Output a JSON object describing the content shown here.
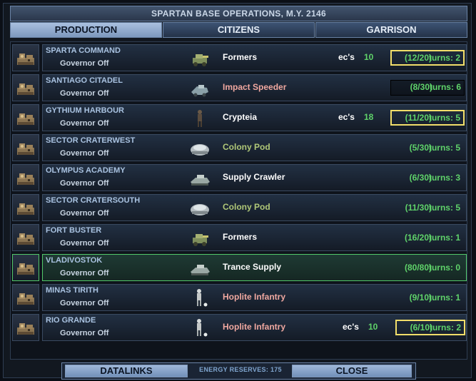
{
  "window": {
    "title": "SPARTAN BASE OPERATIONS,  M.Y. 2146"
  },
  "tabs": [
    {
      "label": "PRODUCTION",
      "active": true
    },
    {
      "label": "CITIZENS",
      "active": false
    },
    {
      "label": "GARRISON",
      "active": false
    }
  ],
  "colors": {
    "green_text": "#5fd36a",
    "white_text": "#ffffff",
    "pink_text": "#f0a8a0",
    "olive_text": "#b0c878",
    "warning_border": "#f2de6a",
    "selected_border": "#52c86a"
  },
  "bases": [
    {
      "name": "SPARTA COMMAND",
      "governor": "Governor Off",
      "unit_icon": "former-icon",
      "item": "Formers",
      "item_color": "white",
      "ec_label": "ec's",
      "ec_value": "10",
      "progress": "(12/20)",
      "turns": "turns: 2",
      "box": "warn",
      "selected": false
    },
    {
      "name": "SANTIAGO CITADEL",
      "governor": "Governor Off",
      "unit_icon": "speeder-icon",
      "item": "Impact Speeder",
      "item_color": "pink",
      "ec_label": "",
      "ec_value": "",
      "progress": "(8/30)",
      "turns": "turns: 6",
      "box": "dark",
      "selected": false
    },
    {
      "name": "GYTHIUM HARBOUR",
      "governor": "Governor Off",
      "unit_icon": "crypteia-icon",
      "item": "Crypteia",
      "item_color": "white",
      "ec_label": "ec's",
      "ec_value": "18",
      "progress": "(11/20)",
      "turns": "turns: 5",
      "box": "warn",
      "selected": false
    },
    {
      "name": "SECTOR CRATERWEST",
      "governor": "Governor Off",
      "unit_icon": "colony-pod-icon",
      "item": "Colony Pod",
      "item_color": "olive",
      "ec_label": "",
      "ec_value": "",
      "progress": "(5/30)",
      "turns": "turns: 5",
      "box": "none",
      "selected": false
    },
    {
      "name": "OLYMPUS ACADEMY",
      "governor": "Governor Off",
      "unit_icon": "supply-crawler-icon",
      "item": "Supply Crawler",
      "item_color": "white",
      "ec_label": "",
      "ec_value": "",
      "progress": "(6/30)",
      "turns": "turns: 3",
      "box": "none",
      "selected": false
    },
    {
      "name": "SECTOR CRATERSOUTH",
      "governor": "Governor Off",
      "unit_icon": "colony-pod-icon",
      "item": "Colony Pod",
      "item_color": "olive",
      "ec_label": "",
      "ec_value": "",
      "progress": "(11/30)",
      "turns": "turns: 5",
      "box": "none",
      "selected": false
    },
    {
      "name": "FORT BUSTER",
      "governor": "Governor Off",
      "unit_icon": "former-icon",
      "item": "Formers",
      "item_color": "white",
      "ec_label": "",
      "ec_value": "",
      "progress": "(16/20)",
      "turns": "turns: 1",
      "box": "none",
      "selected": false
    },
    {
      "name": "VLADIVOSTOK",
      "governor": "Governor Off",
      "unit_icon": "supply-crawler-icon",
      "item": "Trance Supply",
      "item_color": "white",
      "ec_label": "",
      "ec_value": "",
      "progress": "(80/80)",
      "turns": "turns: 0",
      "box": "none",
      "selected": true
    },
    {
      "name": "MINAS TIRITH",
      "governor": "Governor Off",
      "unit_icon": "hoplite-icon",
      "item": "Hoplite Infantry",
      "item_color": "pink",
      "ec_label": "",
      "ec_value": "",
      "progress": "(9/10)",
      "turns": "turns: 1",
      "box": "none",
      "selected": false
    },
    {
      "name": "RIO GRANDE",
      "governor": "Governor Off",
      "unit_icon": "hoplite-icon",
      "item": "Hoplite Infantry",
      "item_color": "pink",
      "ec_label": "ec's",
      "ec_value": "10",
      "progress": "(6/10)",
      "turns": "turns: 2",
      "box": "warn",
      "selected": false
    }
  ],
  "footer": {
    "datalinks_label": "DATALINKS",
    "reserves_text": "ENERGY RESERVES: 175",
    "close_label": "CLOSE"
  }
}
